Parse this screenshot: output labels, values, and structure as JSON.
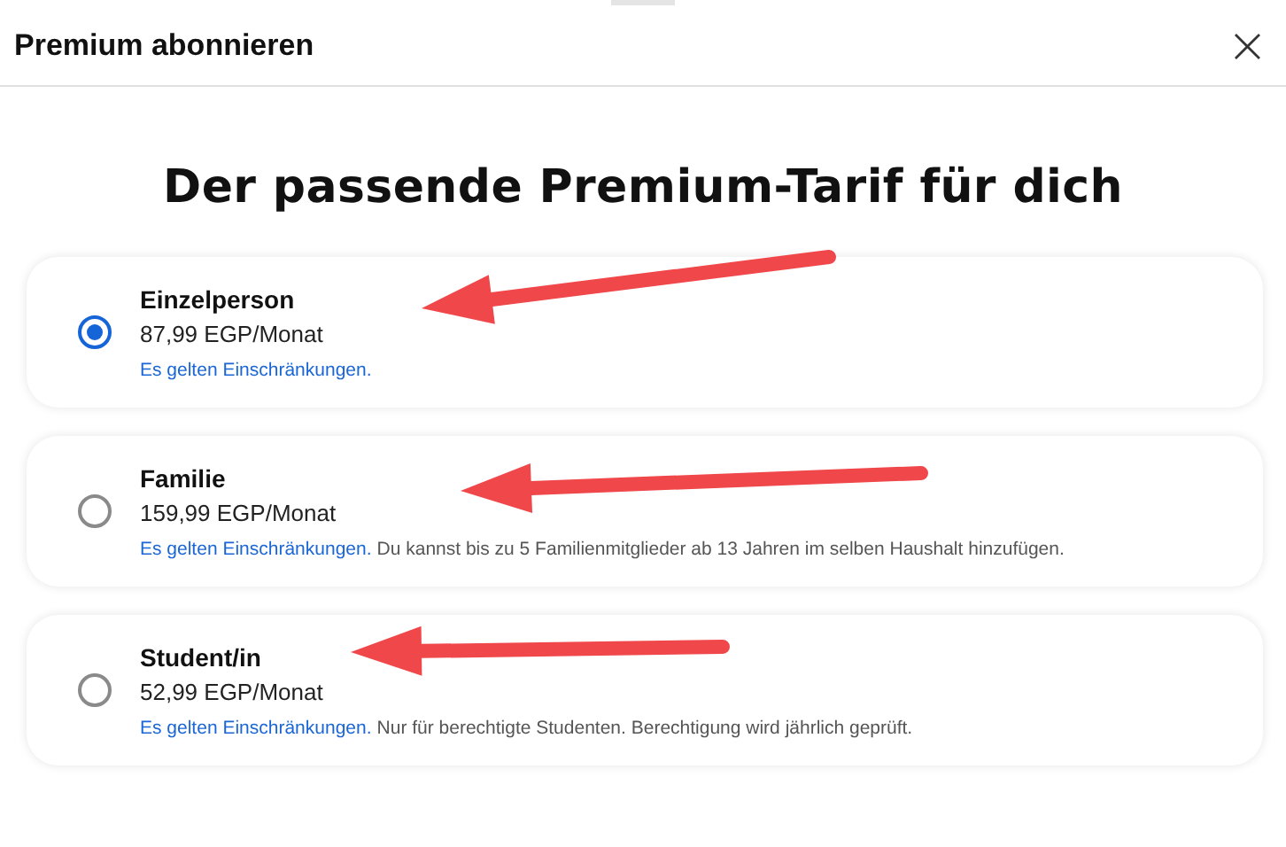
{
  "dialog": {
    "title": "Premium abonnieren",
    "close": "×"
  },
  "heading": "Der passende Premium-Tarif für dich",
  "plans": [
    {
      "name": "Einzelperson",
      "price": "87,99 EGP/Monat",
      "link": "Es gelten Einschränkungen.",
      "selected": true
    },
    {
      "name": "Familie",
      "price": "159,99 EGP/Monat",
      "link": "Es gelten Einschränkungen.",
      "note": "Du kannst bis zu 5 Familienmitglieder ab 13 Jahren im selben Haushalt hinzufügen.",
      "selected": false
    },
    {
      "name": "Student/in",
      "price": "52,99 EGP/Monat",
      "link": "Es gelten Einschränkungen.",
      "note": "Nur für berechtigte Studenten. Berechtigung wird jährlich geprüft.",
      "selected": false
    }
  ]
}
